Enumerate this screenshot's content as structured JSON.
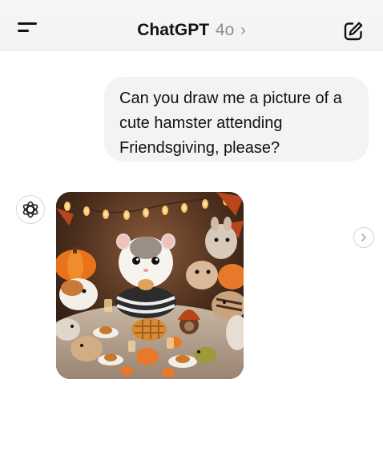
{
  "header": {
    "app_name": "ChatGPT",
    "model": "4o",
    "chevron": "›",
    "menu_icon": "menu-icon",
    "new_chat_icon": "compose-icon"
  },
  "conversation": {
    "user_message": {
      "line1": "Can you draw me a picture of a",
      "line2": "cute hamster attending",
      "line3": "Friendsgiving, please?"
    },
    "assistant": {
      "avatar_icon": "openai-logo-icon",
      "image_description": "generated-image",
      "next_icon": "chevron-right-icon"
    }
  }
}
